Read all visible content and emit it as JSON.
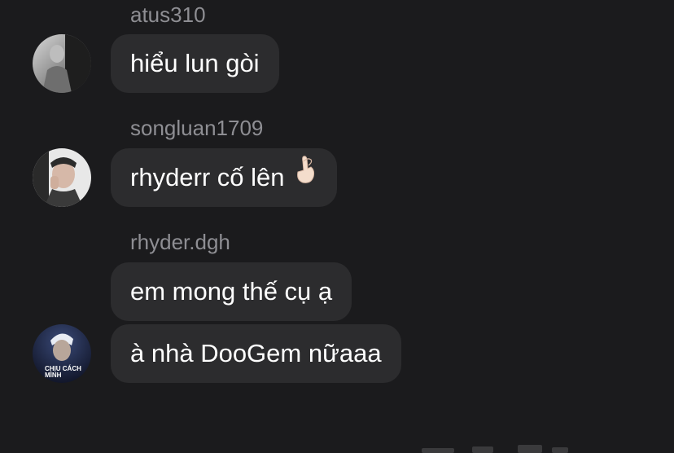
{
  "messages": [
    {
      "username": "atus310",
      "text": "hiểu lun gòi"
    },
    {
      "username": "songluan1709",
      "text": "rhyderr cố lên"
    },
    {
      "username": "rhyder.dgh",
      "text": "em mong thế cụ ạ"
    },
    {
      "username": "",
      "text": "à nhà DooGem nữaaa"
    }
  ],
  "avatars": {
    "rhyder_caption_line1": "CHỊU CÁCH",
    "rhyder_caption_line2": "MÌNH"
  },
  "icons": {
    "heart_hand": "pinched-fingers-heart-icon"
  },
  "colors": {
    "background": "#1b1b1d",
    "bubble": "#2c2c2e",
    "username": "#8e8e93",
    "text": "#ffffff"
  }
}
